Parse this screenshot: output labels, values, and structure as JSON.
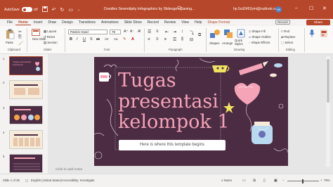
{
  "titlebar": {
    "autosave_label": "AutoSave",
    "autosave_state": "Off",
    "doc_title": "Doodles Serendipity Infographics by Slidesgo • Saving...",
    "account_email": "hp.5cd2452ymi@outlook.com",
    "avatar_initials": "HS"
  },
  "tabs": [
    "File",
    "Home",
    "Insert",
    "Draw",
    "Design",
    "Transitions",
    "Animations",
    "Slide Show",
    "Record",
    "Review",
    "View",
    "Help",
    "Shape Format"
  ],
  "tab_actions": {
    "record": "Record",
    "share": "Share"
  },
  "ribbon": {
    "clipboard": {
      "paste": "Paste",
      "label": "Clipboard"
    },
    "slides": {
      "new_slide": "New Slide",
      "layout": "Layout",
      "reset": "Reset",
      "section": "Section",
      "label": "Slides"
    },
    "font": {
      "name": "Patrick Hand",
      "size": "78",
      "label": "Font",
      "bold": "B",
      "italic": "I",
      "underline": "U",
      "strike": "S",
      "shadow": "ab",
      "spacing": "AV",
      "case": "Aa"
    },
    "paragraph": {
      "label": "Paragraph"
    },
    "drawing": {
      "shapes": "Shapes",
      "arrange": "Arrange",
      "quick_styles": "Quick Styles",
      "shape_fill": "Shape Fill",
      "shape_outline": "Shape Outline",
      "shape_effects": "Shape Effects",
      "label": "Drawing"
    },
    "editing": {
      "find": "Find",
      "replace": "Replace",
      "select": "Select",
      "label": "Editing"
    }
  },
  "thumbnails": [
    {
      "num": "1",
      "title": "Tugas presentasi kelompok"
    },
    {
      "num": "2",
      "title": ""
    },
    {
      "num": "3",
      "title": ""
    },
    {
      "num": "4",
      "title": ""
    },
    {
      "num": "5",
      "title": ""
    }
  ],
  "slide": {
    "title_lines": [
      "Tugas",
      "presentasi",
      "kelompok 1"
    ],
    "caption": "Here is where this template begins"
  },
  "notes_placeholder": "Click to add notes",
  "statusbar": {
    "slide_info": "Slide 1 of 36",
    "language": "English (United States)",
    "accessibility": "Accessibility: Investigate",
    "notes": "Notes",
    "zoom": "78%"
  },
  "colors": {
    "accent": "#b7472a",
    "slide_bg": "#4b2c42",
    "title_pink": "#f5a3b7"
  }
}
